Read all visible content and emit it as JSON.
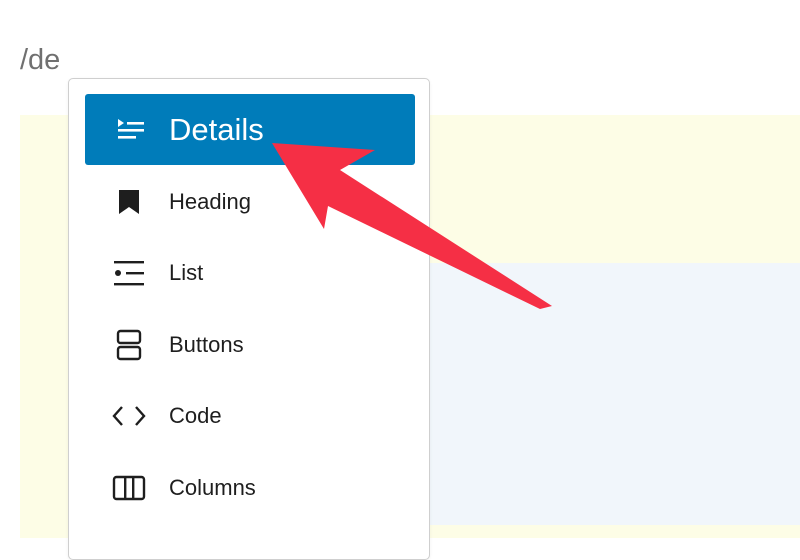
{
  "editor": {
    "slash_command": "/de"
  },
  "menu": {
    "items": [
      {
        "label": "Details",
        "icon": "details-icon",
        "active": true
      },
      {
        "label": "Heading",
        "icon": "bookmark-icon",
        "active": false
      },
      {
        "label": "List",
        "icon": "list-icon",
        "active": false
      },
      {
        "label": "Buttons",
        "icon": "buttons-icon",
        "active": false
      },
      {
        "label": "Code",
        "icon": "code-icon",
        "active": false
      },
      {
        "label": "Columns",
        "icon": "columns-icon",
        "active": false
      }
    ]
  },
  "colors": {
    "accent": "#007cba",
    "annotation_arrow": "#f52f45",
    "yellow_block": "#fdfde6",
    "blue_block": "#f1f6fb"
  }
}
